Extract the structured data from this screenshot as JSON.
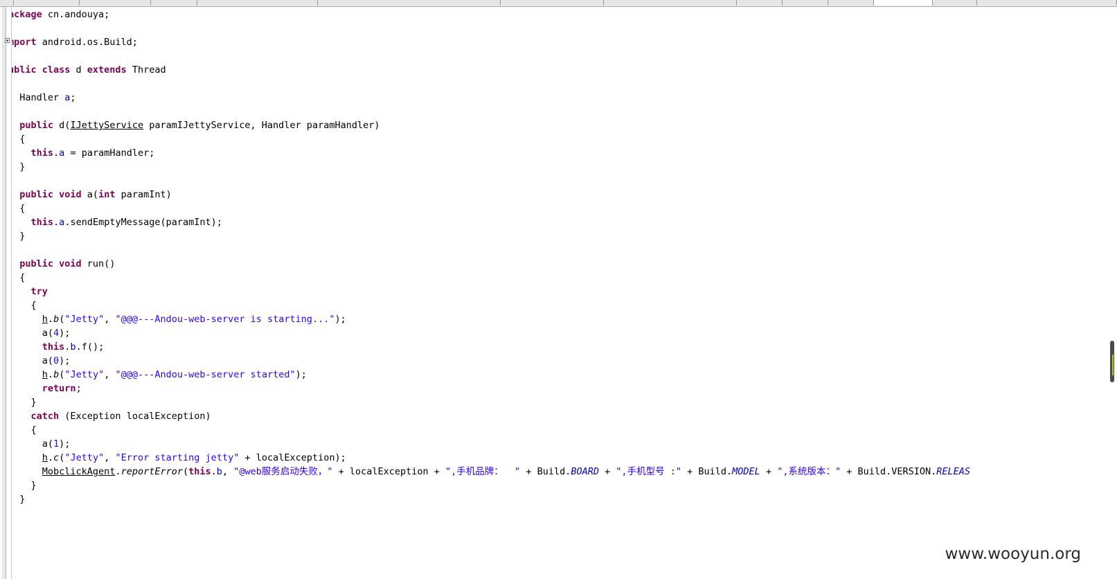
{
  "editor": {
    "language": "java",
    "collapsed_import_marker": "plus-fold-icon",
    "colors": {
      "keyword": "#7f0055",
      "field": "#0000c0",
      "string": "#2a00ff",
      "default": "#000000"
    },
    "lines": [
      [
        {
          "t": "ackage",
          "k": "kw"
        },
        {
          "t": " cn.andouya;"
        }
      ],
      [],
      [
        {
          "t": "mport",
          "k": "kw"
        },
        {
          "t": " android.os.Build;"
        }
      ],
      [],
      [
        {
          "t": "ublic class",
          "k": "kw"
        },
        {
          "t": " d "
        },
        {
          "t": "extends",
          "k": "kw"
        },
        {
          "t": " Thread"
        }
      ],
      [],
      [
        {
          "t": "  Handler "
        },
        {
          "t": "a",
          "k": "fld"
        },
        {
          "t": ";"
        }
      ],
      [],
      [
        {
          "t": "  "
        },
        {
          "t": "public",
          "k": "kw"
        },
        {
          "t": " d("
        },
        {
          "t": "IJettyService",
          "k": "u"
        },
        {
          "t": " paramIJettyService, Handler paramHandler)"
        }
      ],
      [
        {
          "t": "  {"
        }
      ],
      [
        {
          "t": "    "
        },
        {
          "t": "this",
          "k": "kw"
        },
        {
          "t": "."
        },
        {
          "t": "a",
          "k": "fld"
        },
        {
          "t": " = paramHandler;"
        }
      ],
      [
        {
          "t": "  }"
        }
      ],
      [],
      [
        {
          "t": "  "
        },
        {
          "t": "public void",
          "k": "kw"
        },
        {
          "t": " a("
        },
        {
          "t": "int",
          "k": "kw"
        },
        {
          "t": " paramInt)"
        }
      ],
      [
        {
          "t": "  {"
        }
      ],
      [
        {
          "t": "    "
        },
        {
          "t": "this",
          "k": "kw"
        },
        {
          "t": "."
        },
        {
          "t": "a",
          "k": "fld"
        },
        {
          "t": ".sendEmptyMessage(paramInt);"
        }
      ],
      [
        {
          "t": "  }"
        }
      ],
      [],
      [
        {
          "t": "  "
        },
        {
          "t": "public void",
          "k": "kw"
        },
        {
          "t": " run()"
        }
      ],
      [
        {
          "t": "  {"
        }
      ],
      [
        {
          "t": "    "
        },
        {
          "t": "try",
          "k": "kw"
        }
      ],
      [
        {
          "t": "    {"
        }
      ],
      [
        {
          "t": "      "
        },
        {
          "t": "h",
          "k": "u"
        },
        {
          "t": "."
        },
        {
          "t": "b",
          "k": "i"
        },
        {
          "t": "("
        },
        {
          "t": "\"Jetty\"",
          "k": "str"
        },
        {
          "t": ", "
        },
        {
          "t": "\"@@@---Andou-web-server is starting...\"",
          "k": "str"
        },
        {
          "t": ");"
        }
      ],
      [
        {
          "t": "      a("
        },
        {
          "t": "4",
          "k": "num"
        },
        {
          "t": ");"
        }
      ],
      [
        {
          "t": "      "
        },
        {
          "t": "this",
          "k": "kw"
        },
        {
          "t": "."
        },
        {
          "t": "b",
          "k": "fld"
        },
        {
          "t": ".f();"
        }
      ],
      [
        {
          "t": "      a("
        },
        {
          "t": "0",
          "k": "num"
        },
        {
          "t": ");"
        }
      ],
      [
        {
          "t": "      "
        },
        {
          "t": "h",
          "k": "u"
        },
        {
          "t": "."
        },
        {
          "t": "b",
          "k": "i"
        },
        {
          "t": "("
        },
        {
          "t": "\"Jetty\"",
          "k": "str"
        },
        {
          "t": ", "
        },
        {
          "t": "\"@@@---Andou-web-server started\"",
          "k": "str"
        },
        {
          "t": ");"
        }
      ],
      [
        {
          "t": "      "
        },
        {
          "t": "return",
          "k": "kw"
        },
        {
          "t": ";"
        }
      ],
      [
        {
          "t": "    }"
        }
      ],
      [
        {
          "t": "    "
        },
        {
          "t": "catch",
          "k": "kw"
        },
        {
          "t": " (Exception localException)"
        }
      ],
      [
        {
          "t": "    {"
        }
      ],
      [
        {
          "t": "      a("
        },
        {
          "t": "1",
          "k": "num"
        },
        {
          "t": ");"
        }
      ],
      [
        {
          "t": "      "
        },
        {
          "t": "h",
          "k": "u"
        },
        {
          "t": "."
        },
        {
          "t": "c",
          "k": "i"
        },
        {
          "t": "("
        },
        {
          "t": "\"Jetty\"",
          "k": "str"
        },
        {
          "t": ", "
        },
        {
          "t": "\"Error starting jetty\"",
          "k": "str"
        },
        {
          "t": " + localException);"
        }
      ],
      [
        {
          "t": "      "
        },
        {
          "t": "MobclickAgent",
          "k": "u"
        },
        {
          "t": "."
        },
        {
          "t": "reportError",
          "k": "i"
        },
        {
          "t": "("
        },
        {
          "t": "this",
          "k": "kw"
        },
        {
          "t": "."
        },
        {
          "t": "b",
          "k": "fld"
        },
        {
          "t": ", "
        },
        {
          "t": "\"@web服务启动失败，\"",
          "k": "str"
        },
        {
          "t": " + localException + "
        },
        {
          "t": "\",手机品牌：  \"",
          "k": "str"
        },
        {
          "t": " + Build."
        },
        {
          "t": "BOARD",
          "k": "fld i"
        },
        {
          "t": " + "
        },
        {
          "t": "\",手机型号 :\"",
          "k": "str"
        },
        {
          "t": " + Build."
        },
        {
          "t": "MODEL",
          "k": "fld i"
        },
        {
          "t": " + "
        },
        {
          "t": "\",系统版本：\"",
          "k": "str"
        },
        {
          "t": " + Build.VERSION."
        },
        {
          "t": "RELEAS",
          "k": "fld i"
        }
      ],
      [
        {
          "t": "    }"
        }
      ],
      [
        {
          "t": "  }"
        }
      ]
    ]
  },
  "watermark": "www.wooyun.org"
}
